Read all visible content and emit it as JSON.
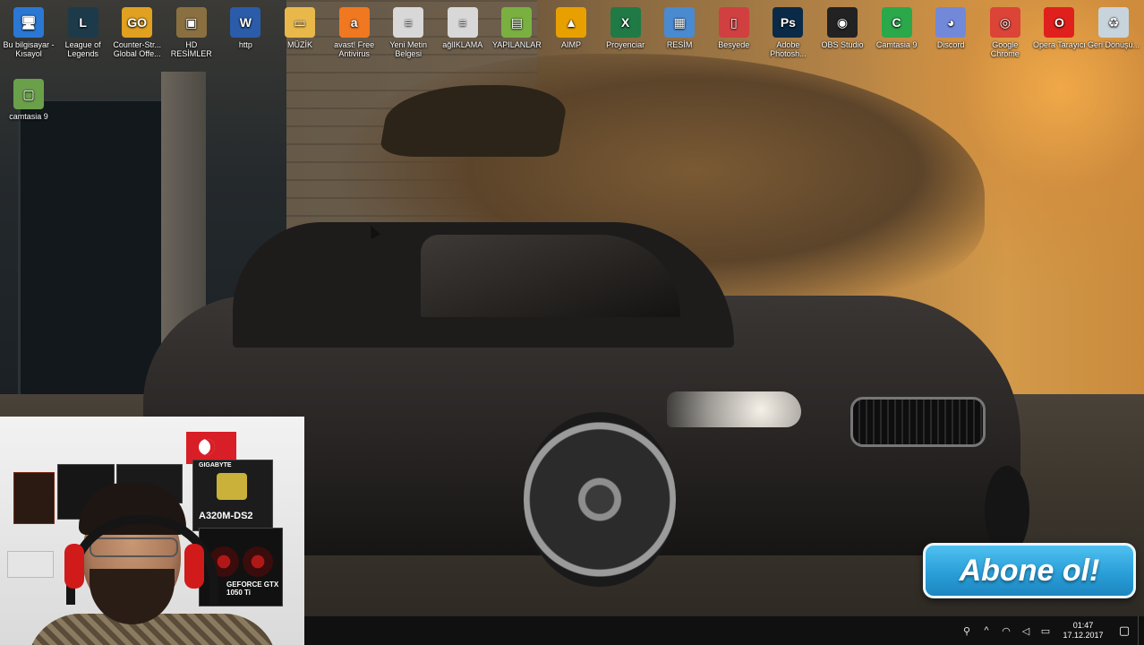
{
  "desktop": {
    "icons": [
      {
        "label": "Bu bilgisayar - Kısayol",
        "icon": "computer-icon",
        "color": "#2b78d4",
        "glyph": "🖥"
      },
      {
        "label": "League of Legends",
        "icon": "league-of-legends-icon",
        "color": "#1d3a4a",
        "glyph": "L"
      },
      {
        "label": "Counter-Str... Global Offe...",
        "icon": "csgo-icon",
        "color": "#e0a020",
        "glyph": "GO"
      },
      {
        "label": "HD RESİMLER",
        "icon": "image-folder-icon",
        "color": "#8a7040",
        "glyph": "▣"
      },
      {
        "label": "http",
        "icon": "word-document-icon",
        "color": "#2a5caa",
        "glyph": "W"
      },
      {
        "label": "MÜZİK",
        "icon": "folder-icon",
        "color": "#e8b84a",
        "glyph": "▭"
      },
      {
        "label": "avast! Free Antivirus",
        "icon": "avast-icon",
        "color": "#f07820",
        "glyph": "a"
      },
      {
        "label": "Yeni Metin Belgesi",
        "icon": "text-document-icon",
        "color": "#d8d8d8",
        "glyph": "≡"
      },
      {
        "label": "ağlIKLAMA",
        "icon": "text-document-icon",
        "color": "#d8d8d8",
        "glyph": "≡"
      },
      {
        "label": "YAPILANLAR",
        "icon": "spreadsheet-icon",
        "color": "#7ab040",
        "glyph": "▤"
      },
      {
        "label": "AIMP",
        "icon": "aimp-icon",
        "color": "#e8a000",
        "glyph": "▲"
      },
      {
        "label": "Proyenciar",
        "icon": "excel-icon",
        "color": "#1f7a45",
        "glyph": "X"
      },
      {
        "label": "RESİM",
        "icon": "image-icon",
        "color": "#4a8ad0",
        "glyph": "▦"
      },
      {
        "label": "Besyede",
        "icon": "document-icon",
        "color": "#d04040",
        "glyph": "▯"
      },
      {
        "label": "Adobe Photosh...",
        "icon": "photoshop-icon",
        "color": "#0a2a48",
        "glyph": "Ps"
      },
      {
        "label": "OBS Studio",
        "icon": "obs-icon",
        "color": "#222222",
        "glyph": "◉"
      },
      {
        "label": "Camtasia 9",
        "icon": "camtasia-icon",
        "color": "#2aa84a",
        "glyph": "C"
      },
      {
        "label": "Discord",
        "icon": "discord-icon",
        "color": "#7289da",
        "glyph": "◕"
      },
      {
        "label": "Google Chrome",
        "icon": "chrome-icon",
        "color": "#db4437",
        "glyph": "◎"
      },
      {
        "label": "Opera Tarayıcı",
        "icon": "opera-icon",
        "color": "#e0201c",
        "glyph": "O"
      },
      {
        "label": "Geri Dönüşü...",
        "icon": "recycle-bin-icon",
        "color": "#c8d4dc",
        "glyph": "♻"
      }
    ],
    "second_row": [
      {
        "label": "camtasia 9",
        "icon": "camtasia-project-icon",
        "color": "#6aa04a",
        "glyph": "▢"
      }
    ]
  },
  "webcam": {
    "motherboard_brand": "GIGABYTE",
    "motherboard_model": "A320M-DS2",
    "gpu_model": "GEFORCE GTX 1050 Ti"
  },
  "overlay": {
    "subscribe_label": "Abone ol!"
  },
  "taskbar": {
    "tray_icons": [
      "people-icon",
      "chevron-up-icon",
      "wifi-icon",
      "volume-icon",
      "keyboard-icon"
    ],
    "time": "01:47",
    "date": "17.12.2017",
    "notification_icon": "notification-icon"
  }
}
